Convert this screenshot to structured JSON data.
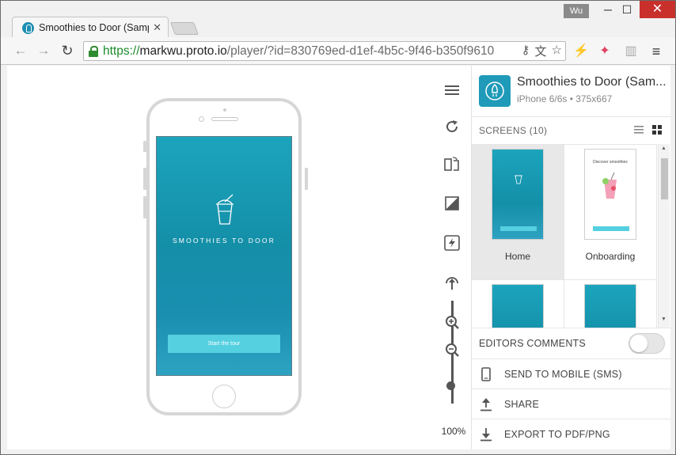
{
  "browser": {
    "tab_title": "Smoothies to Door (Samp",
    "tab_close": "✕",
    "user": "Wu",
    "window_minimize": "─",
    "window_maximize": "☐",
    "window_close": "✕",
    "url_scheme": "https://",
    "url_host": "markwu.proto.io",
    "url_path": "/player/?id=830769ed-d1ef-4b5c-9f46-b350f9610",
    "back": "←",
    "forward": "→",
    "reload": "↻",
    "key_icon": "⚷",
    "translate_icon": "文",
    "star_icon": "☆",
    "ext_bolt": "⚡",
    "ext_pin": "✦",
    "ext_panel": "▥",
    "menu": "≡"
  },
  "device_preview": {
    "brand": "SMOOTHIES TO DOOR",
    "cta_label": "Start the tour"
  },
  "tools": {
    "zoom_level": "100%"
  },
  "panel": {
    "project_title": "Smoothies to Door (Sam...",
    "device_info": "iPhone 6/6s • 375x667",
    "screens_label": "SCREENS (10)",
    "screens": [
      {
        "label": "Home",
        "selected": true,
        "style": "teal"
      },
      {
        "label": "Onboarding",
        "selected": false,
        "style": "white"
      },
      {
        "label": "",
        "selected": false,
        "style": "teal"
      },
      {
        "label": "",
        "selected": false,
        "style": "teal"
      }
    ],
    "onboarding_thumb_title": "Discover smoothies",
    "editors_comments_label": "EDITORS COMMENTS",
    "editors_comments_on": false,
    "send_to_mobile_label": "SEND TO MOBILE (SMS)",
    "share_label": "SHARE",
    "export_label": "EXPORT TO PDF/PNG"
  },
  "colors": {
    "accent_teal": "#1f9ab8",
    "button_cyan": "#54d0e0",
    "close_red": "#c9302c"
  }
}
